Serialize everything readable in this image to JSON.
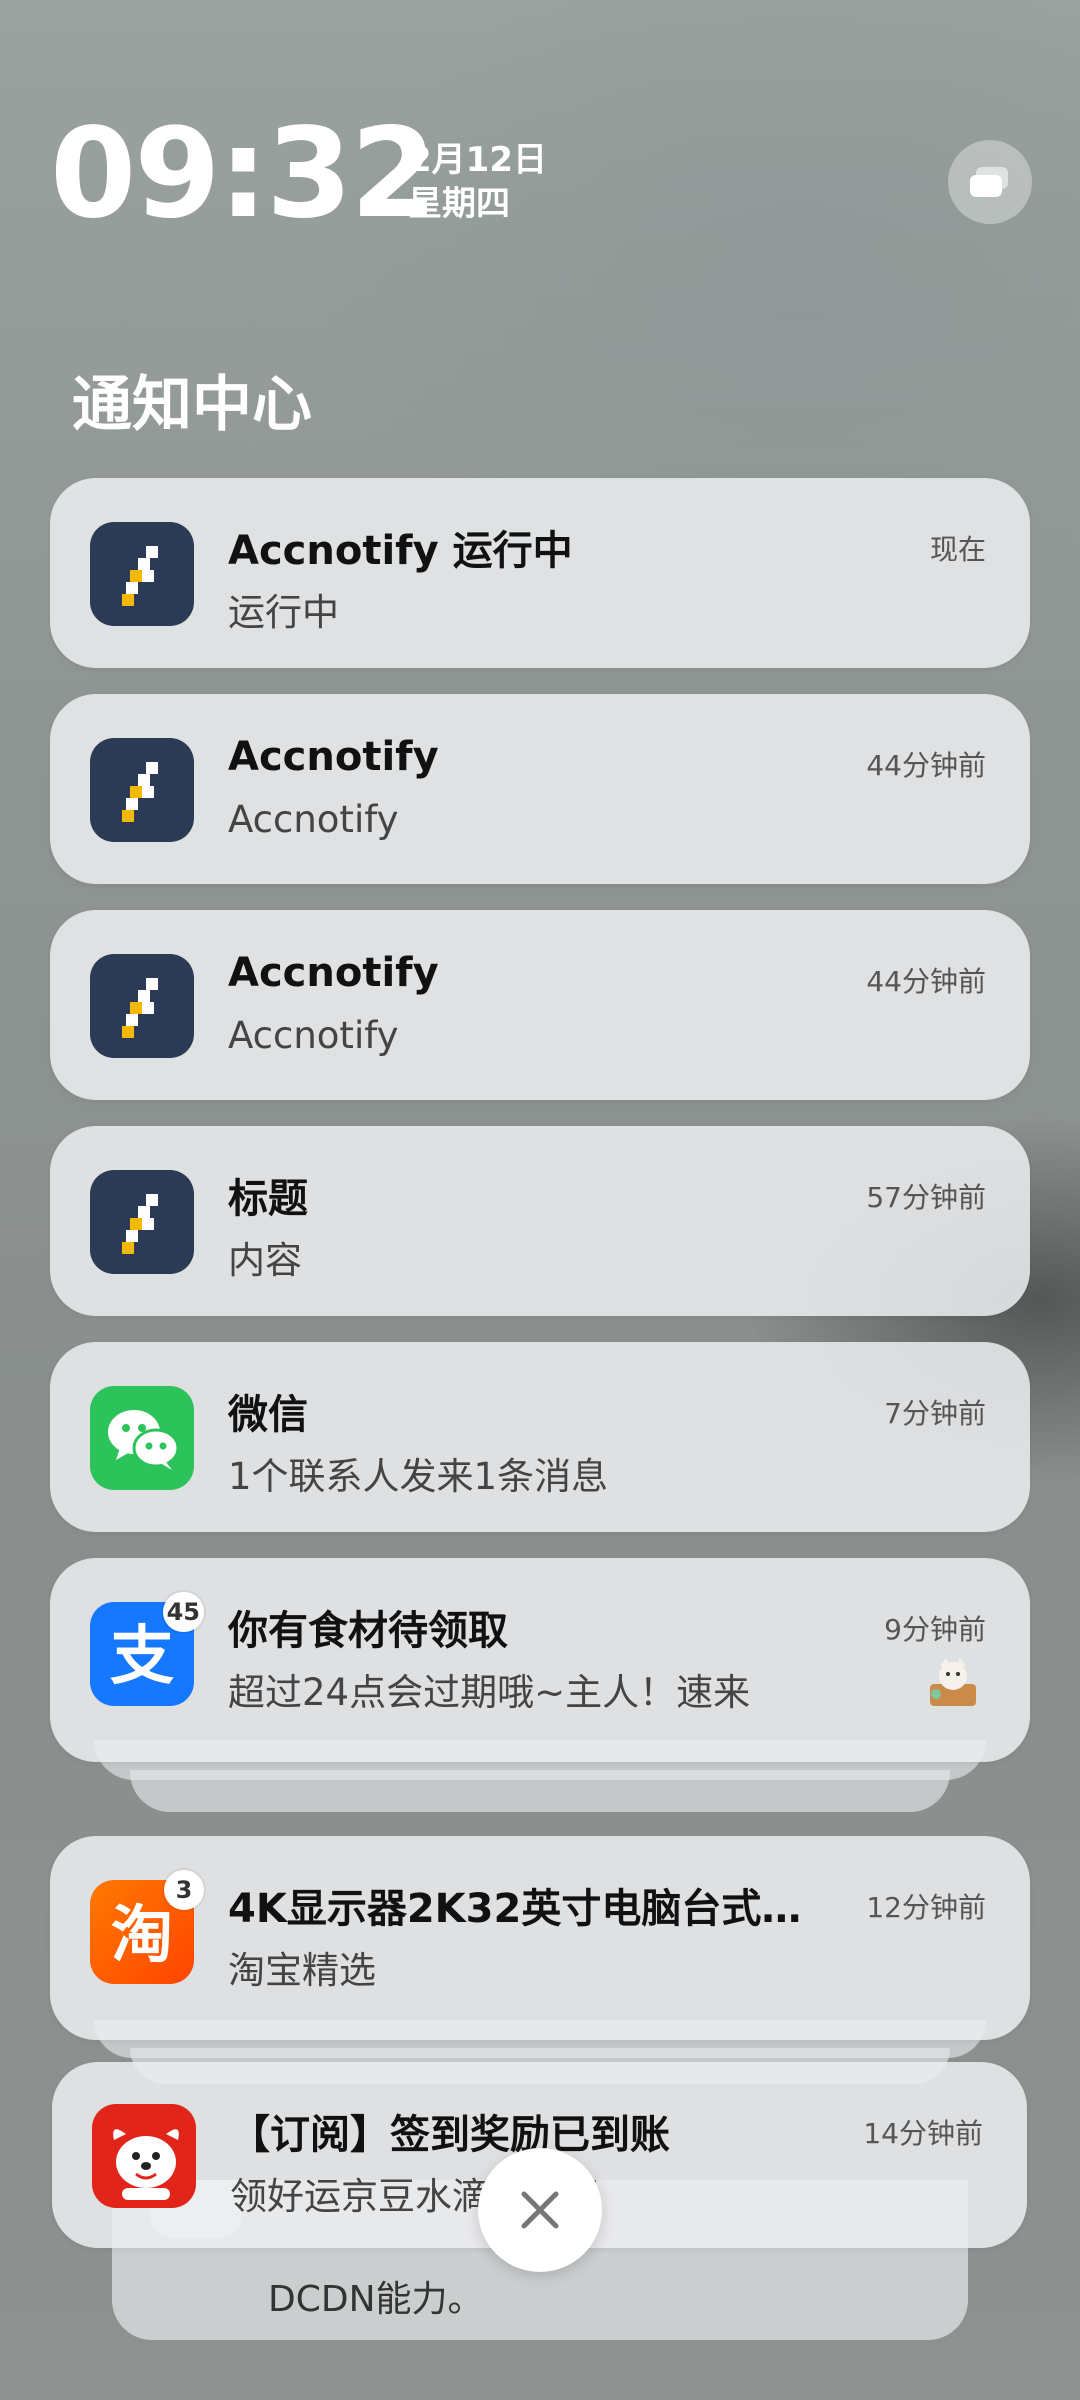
{
  "status": {
    "time": "09:32",
    "date": "2月12日",
    "weekday": "星期四"
  },
  "header": {
    "title": "通知中心"
  },
  "notifications": [
    {
      "app": "Accnotify",
      "title": "Accnotify 运行中",
      "body": "运行中",
      "time": "现在"
    },
    {
      "app": "Accnotify",
      "title": "Accnotify",
      "body": "Accnotify",
      "time": "44分钟前"
    },
    {
      "app": "Accnotify",
      "title": "Accnotify",
      "body": "Accnotify",
      "time": "44分钟前"
    },
    {
      "app": "Accnotify",
      "title": "标题",
      "body": "内容",
      "time": "57分钟前"
    },
    {
      "app": "微信",
      "title": "微信",
      "body": "1个联系人发来1条消息",
      "time": "7分钟前"
    },
    {
      "app": "支付宝",
      "title": "你有食材待领取",
      "body": "超过24点会过期哦~主人！速来",
      "time": "9分钟前",
      "badge": "45"
    },
    {
      "app": "淘宝",
      "title": "4K显示器2K32英寸电脑台式…",
      "body": "淘宝精选",
      "time": "12分钟前",
      "badge": "3"
    },
    {
      "app": "京东",
      "title": "【订阅】签到奖励已到账",
      "body": "领好运京豆水滴开好运",
      "time": "14分钟前"
    }
  ],
  "peek": {
    "text": "DCDN能力。"
  },
  "colors": {
    "accnotify_bg": "#2b3a55",
    "accnotify_accent": "#f5b800",
    "wechat": "#2dc35b",
    "alipay": "#1677ff",
    "taobao": "#ff5000",
    "jd": "#e1251b"
  }
}
